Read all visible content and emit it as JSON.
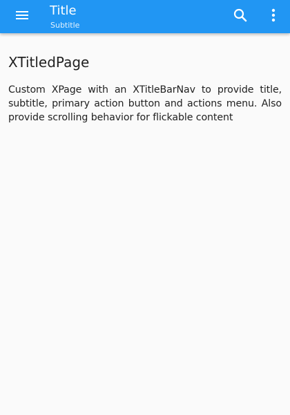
{
  "titlebar": {
    "title": "Title",
    "subtitle": "Subtitle",
    "nav_icon": "hamburger-menu-icon",
    "actions": [
      {
        "icon": "search-icon"
      },
      {
        "icon": "more-vertical-icon"
      }
    ],
    "background_color": "#2196F3"
  },
  "page": {
    "heading": "XTitledPage",
    "description": "Custom XPage with an XTitleBarNav to provide title, subtitle, primary action button and actions menu. Also provide scrolling behavior for flickable content"
  }
}
